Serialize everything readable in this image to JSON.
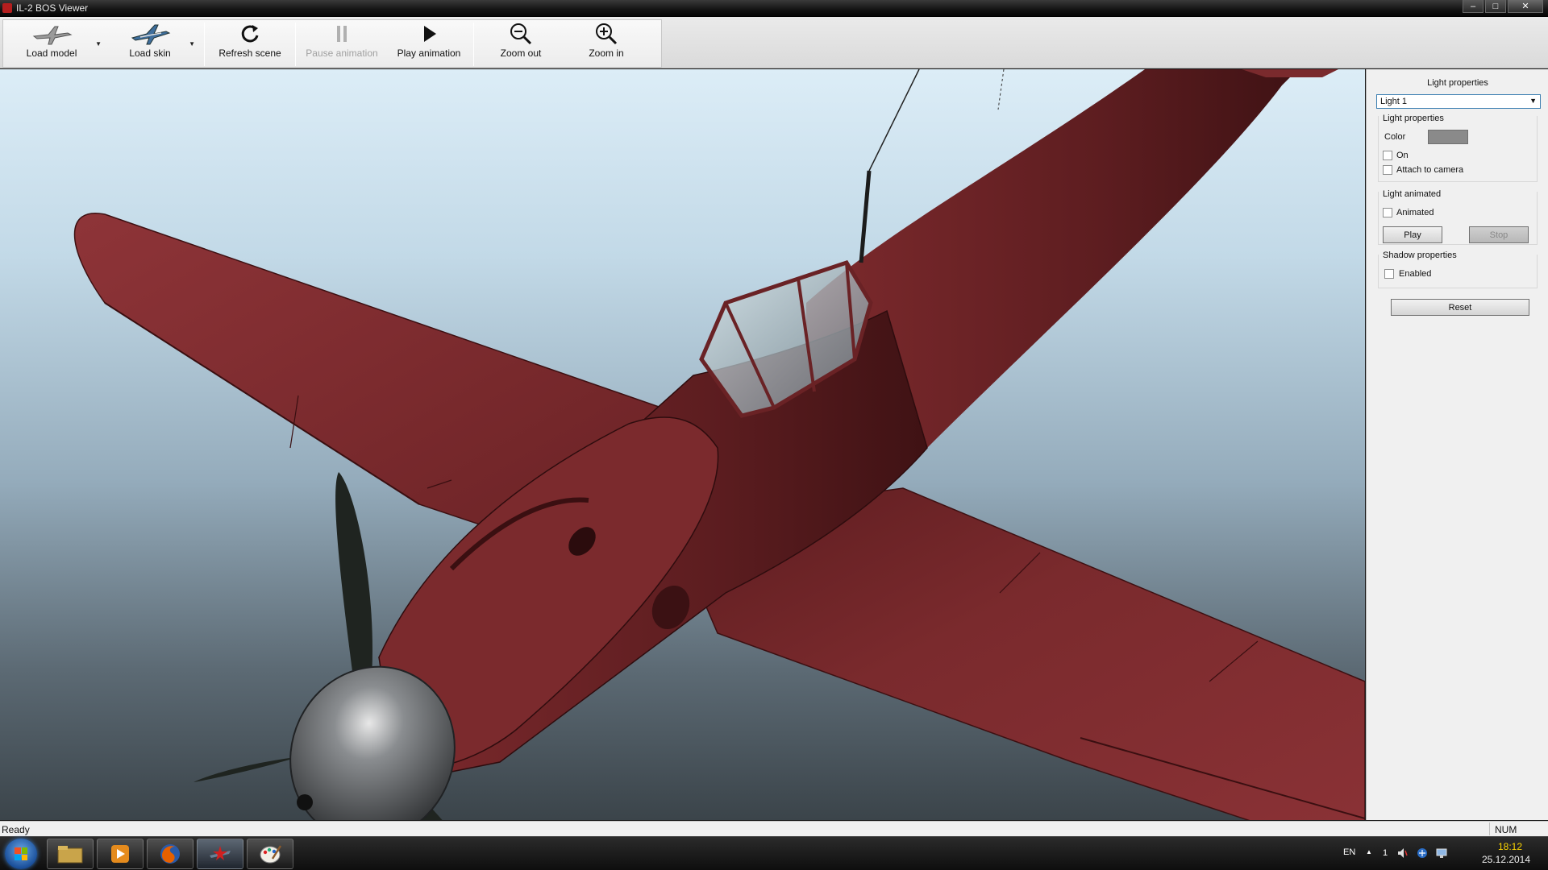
{
  "window": {
    "title": "IL-2 BOS Viewer",
    "controls": {
      "minimize": "–",
      "maximize": "□",
      "close": "✕"
    }
  },
  "toolbar": {
    "items": [
      {
        "label": "Load model",
        "icon": "plane-icon",
        "enabled": true,
        "has_dropdown": true
      },
      {
        "label": "Load skin",
        "icon": "skin-plane-icon",
        "enabled": true,
        "has_dropdown": true
      },
      {
        "label": "Refresh scene",
        "icon": "refresh-icon",
        "enabled": true,
        "has_dropdown": false
      },
      {
        "label": "Pause animation",
        "icon": "pause-icon",
        "enabled": false,
        "has_dropdown": false
      },
      {
        "label": "Play animation",
        "icon": "play-icon",
        "enabled": true,
        "has_dropdown": false
      },
      {
        "label": "Zoom out",
        "icon": "zoom-out-icon",
        "enabled": true,
        "has_dropdown": false
      },
      {
        "label": "Zoom in",
        "icon": "zoom-in-icon",
        "enabled": true,
        "has_dropdown": false
      }
    ]
  },
  "panel": {
    "title": "Light properties",
    "light_select": {
      "value": "Light 1"
    },
    "light_group": {
      "title": "Light properties",
      "color_label": "Color",
      "color_value": "#8a8a8a",
      "on_label": "On",
      "on_checked": false,
      "attach_label": "Attach to camera",
      "attach_checked": false
    },
    "animated_group": {
      "title": "Light animated",
      "animated_label": "Animated",
      "animated_checked": false,
      "play_label": "Play",
      "stop_label": "Stop"
    },
    "shadow_group": {
      "title": "Shadow properties",
      "enabled_label": "Enabled",
      "enabled_checked": false
    },
    "reset_label": "Reset"
  },
  "statusbar": {
    "text": "Ready",
    "num": "NUM"
  },
  "taskbar": {
    "apps": [
      "start-orb",
      "file-manager",
      "media-player",
      "firefox",
      "il2-viewer",
      "paint"
    ],
    "tray": {
      "lang": "EN",
      "count": "1",
      "time": "18:12",
      "date": "25.12.2014"
    }
  },
  "colors": {
    "plane_red": "#7e2b2e",
    "spinner_grey": "#6b6e70",
    "sky_top": "#dcedf7",
    "sky_bottom": "#3b444a"
  }
}
